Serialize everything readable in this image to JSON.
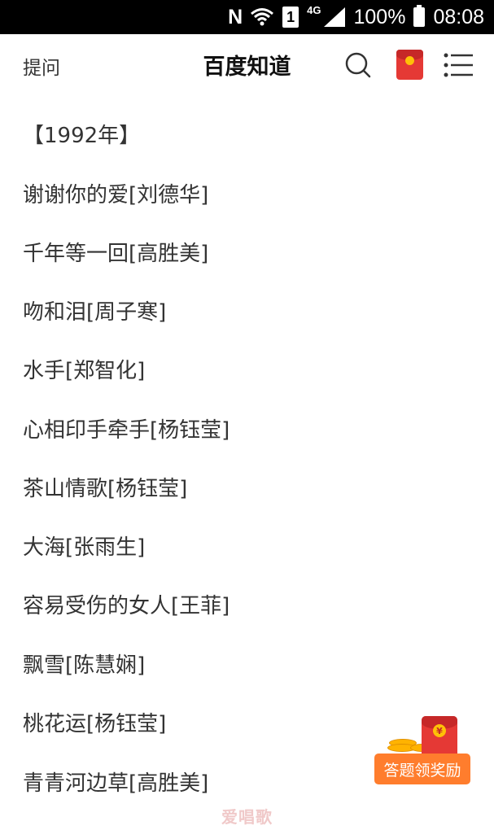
{
  "status_bar": {
    "nfc_label": "N",
    "sim_label": "1",
    "network_label": "4G",
    "battery_text": "100%",
    "time": "08:08"
  },
  "header": {
    "left_link": "提问",
    "title": "百度知道",
    "icons": [
      "search-icon",
      "red-packet-icon",
      "menu-icon"
    ]
  },
  "content": {
    "year_heading": "【1992年】",
    "songs": [
      "谢谢你的爱[刘德华]",
      "千年等一回[高胜美]",
      "吻和泪[周子寒]",
      "水手[郑智化]",
      "心相印手牵手[杨钰莹]",
      "茶山情歌[杨钰莹]",
      "大海[张雨生]",
      "容易受伤的女人[王菲]",
      "飘雪[陈慧娴]",
      "桃花运[杨钰莹]",
      "青青河边草[高胜美]"
    ]
  },
  "reward_widget": {
    "label": "答题领奖励",
    "seal": "¥",
    "accent_color": "#ff7d2d"
  },
  "watermark": "爱唱歌",
  "colors": {
    "status_bar_bg": "#000000",
    "text": "#333333",
    "red_packet": "#e53935"
  }
}
